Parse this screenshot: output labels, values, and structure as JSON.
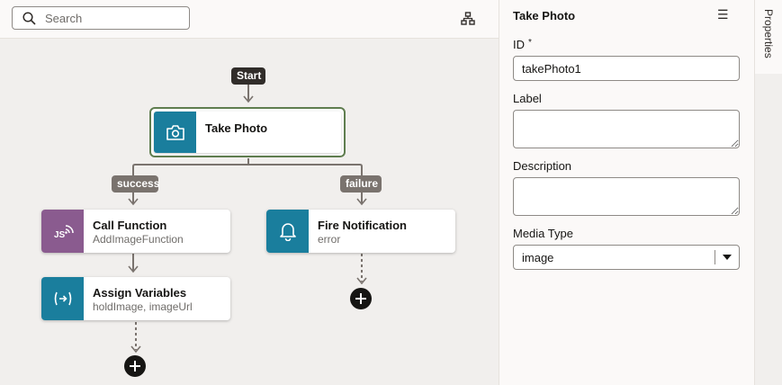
{
  "search": {
    "placeholder": "Search"
  },
  "flow": {
    "start_label": "Start",
    "nodes": {
      "take_photo": {
        "title": "Take Photo",
        "subtitle": ""
      },
      "call_function": {
        "title": "Call Function",
        "subtitle": "AddImageFunction"
      },
      "assign_variables": {
        "title": "Assign Variables",
        "subtitle": "holdImage, imageUrl"
      },
      "fire_notification": {
        "title": "Fire Notification",
        "subtitle": "error"
      }
    },
    "branches": {
      "success": "success",
      "failure": "failure"
    }
  },
  "panel": {
    "title": "Take Photo",
    "menu_icon": "☰",
    "fields": {
      "id_label": "ID",
      "id_required": "*",
      "id_value": "takePhoto1",
      "label_label": "Label",
      "label_value": "",
      "description_label": "Description",
      "description_value": "",
      "media_type_label": "Media Type",
      "media_type_value": "image"
    }
  },
  "side_tab": {
    "label": "Properties"
  },
  "colors": {
    "selected_border": "#5f7d4f",
    "action_blue": "#1a7e9d",
    "function_purple": "#8a5b8f",
    "canvas_bg": "#f1efed"
  }
}
